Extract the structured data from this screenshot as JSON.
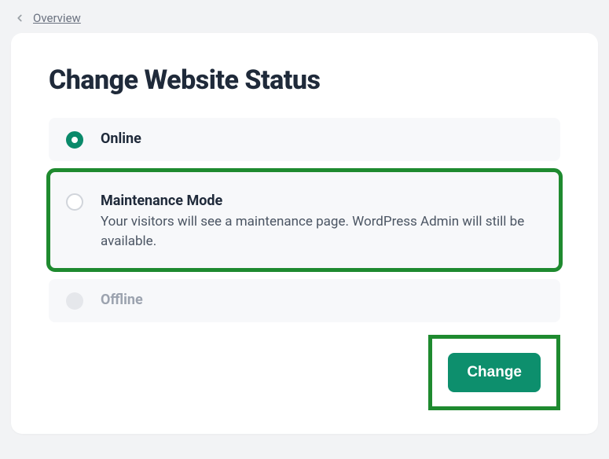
{
  "breadcrumb": {
    "label": "Overview"
  },
  "page": {
    "title": "Change Website Status"
  },
  "options": {
    "online": {
      "label": "Online"
    },
    "maintenance": {
      "label": "Maintenance Mode",
      "description": "Your visitors will see a maintenance page. WordPress Admin will still be available."
    },
    "offline": {
      "label": "Offline"
    }
  },
  "actions": {
    "submit": "Change"
  }
}
